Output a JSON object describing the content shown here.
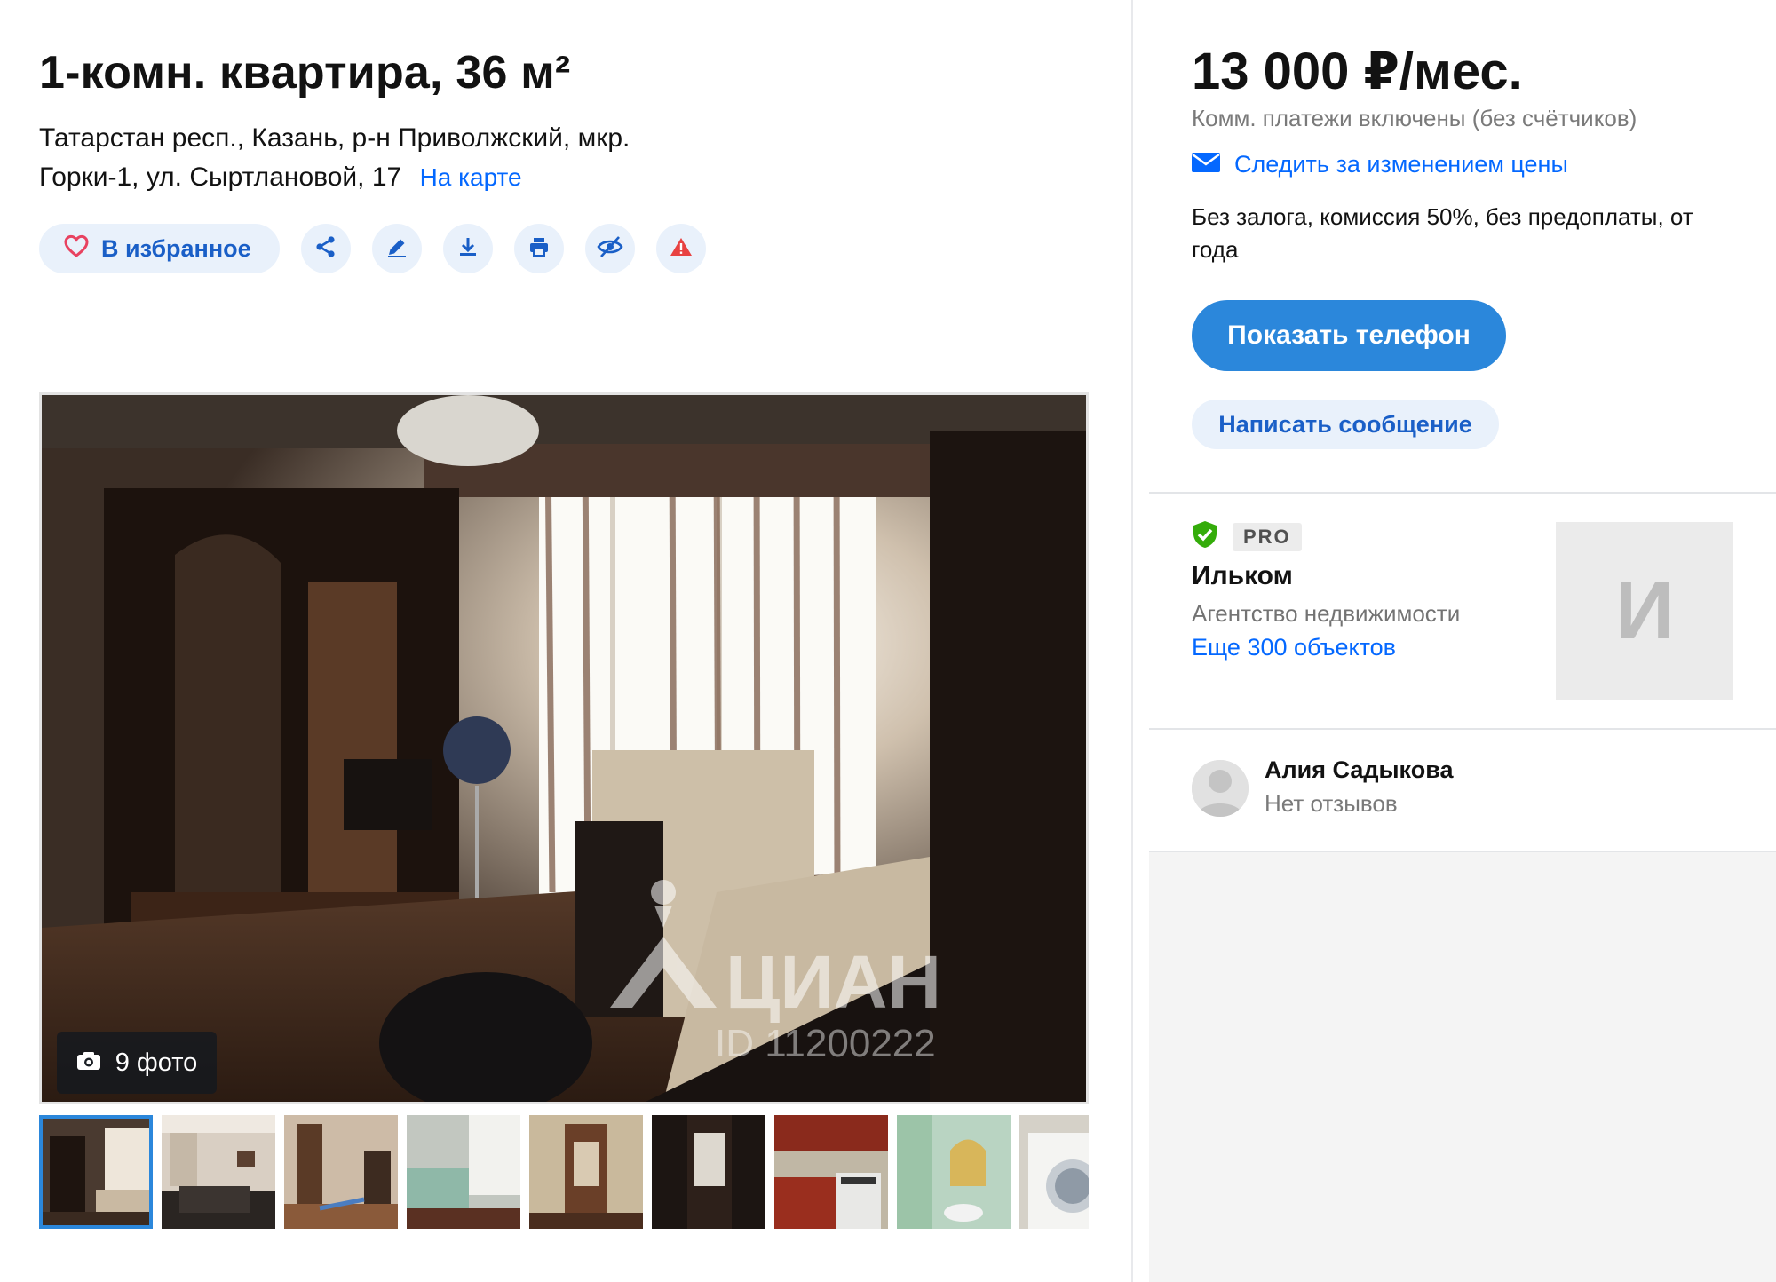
{
  "listing": {
    "title": "1-комн. квартира, 36 м²",
    "address": "Татарстан респ., Казань, р-н Приволжский, мкр. Горки-1, ул. Сыртлановой, 17",
    "map_link": "На карте"
  },
  "actions": {
    "favorite_label": "В избранное",
    "icons": [
      "share-icon",
      "edit-icon",
      "download-icon",
      "print-icon",
      "hide-icon",
      "report-icon"
    ]
  },
  "gallery": {
    "photo_count": "9 фото",
    "watermark_brand": "ЦИАН",
    "watermark_id": "ID 11200222",
    "thumbnails": [
      "living-room",
      "living-room-sofa",
      "room-ironing-board",
      "balcony",
      "hallway",
      "door-hallway",
      "kitchen",
      "bathroom",
      "washing-machine"
    ],
    "active_thumbnail": 0
  },
  "price_card": {
    "price": "13 000 ₽/мес.",
    "note": "Комм. платежи включены (без счётчиков)",
    "watch_label": "Следить за изменением цены",
    "terms": "Без залога, комиссия 50%, без предоплаты, от года",
    "phone_button": "Показать телефон",
    "message_button": "Написать сообщение"
  },
  "agency": {
    "badge": "PRO",
    "name": "Ильком",
    "type": "Агентство недвижимости",
    "more_link": "Еще 300 объектов",
    "logo_letter": "И"
  },
  "agent": {
    "name": "Алия Садыкова",
    "reviews": "Нет отзывов"
  },
  "colors": {
    "accent_blue": "#2b87db",
    "link_blue": "#0468ff",
    "button_light": "#e9f1fb",
    "favorite_heart": "#e84260",
    "report_red": "#e84242",
    "verified_green": "#34ac0a"
  }
}
